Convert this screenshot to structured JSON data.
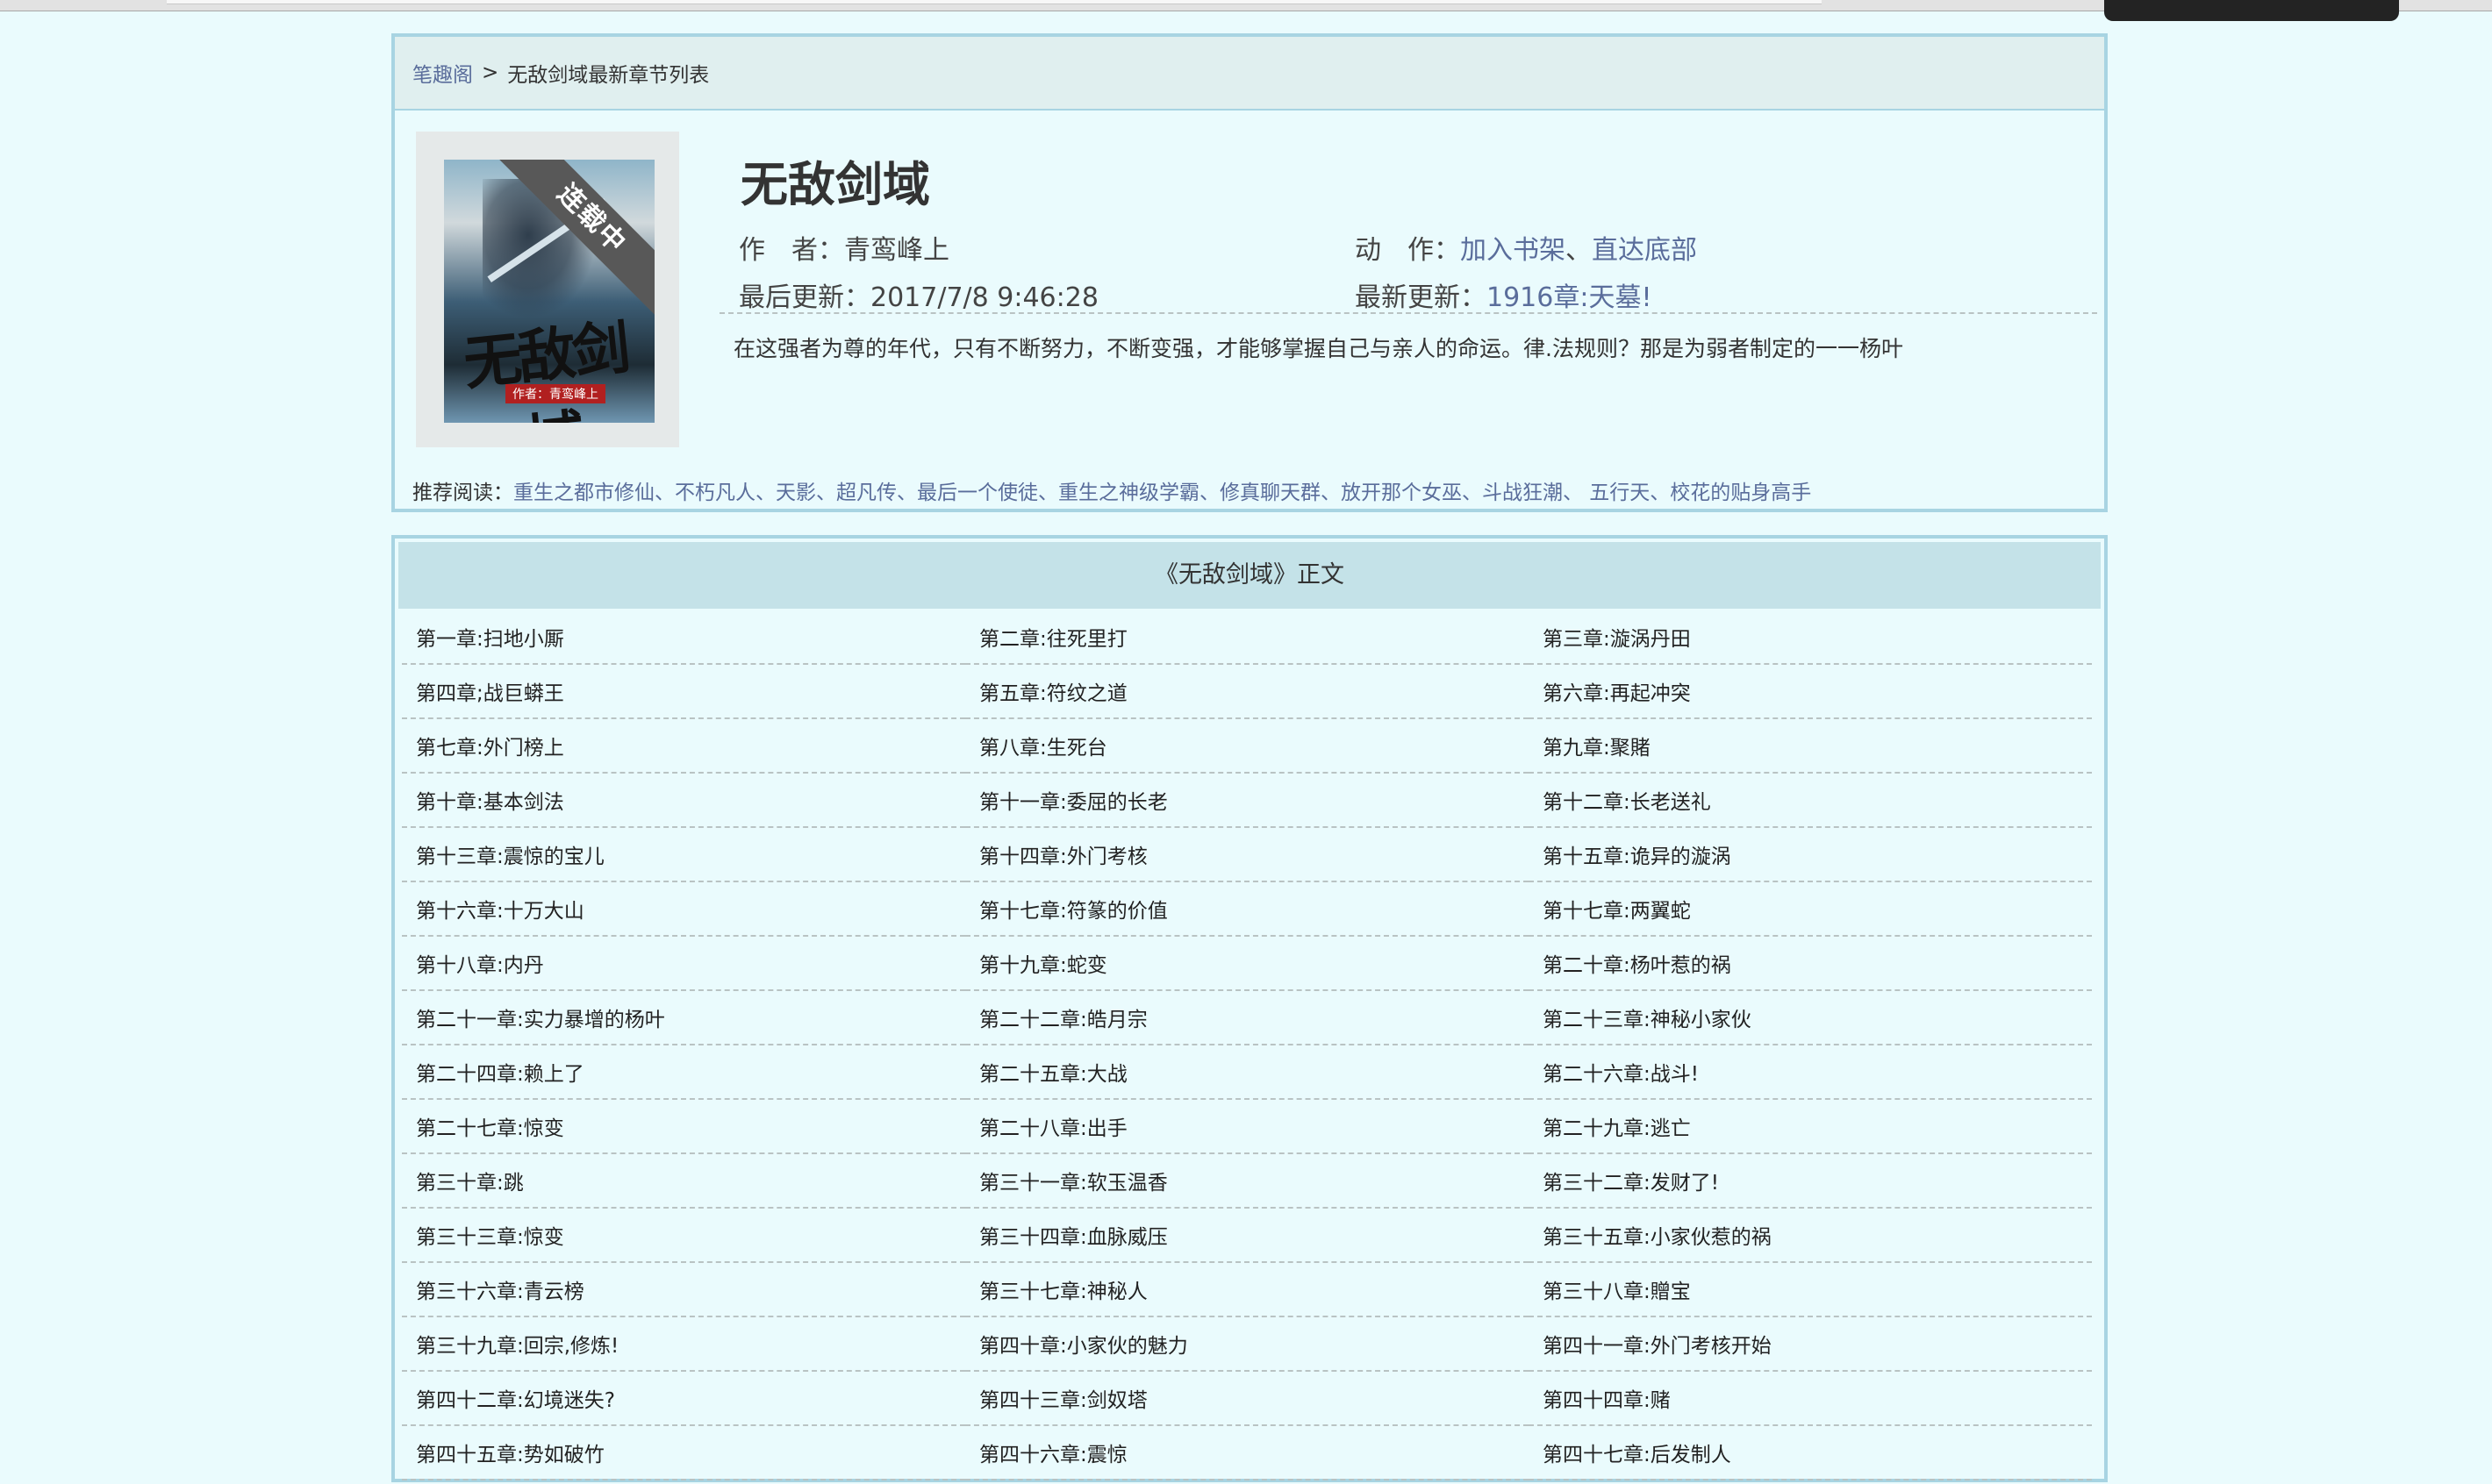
{
  "breadcrumb": {
    "home": "笔趣阁",
    "separator": ">",
    "current": "无敌剑域最新章节列表"
  },
  "book": {
    "cover_ribbon": "连载中",
    "cover_title": "无敌剑域",
    "cover_author": "作者：青鸾峰上",
    "title": "无敌剑域",
    "author_label": "作　者：",
    "author": "青鸾峰上",
    "action_label": "动　作：",
    "action_shelf": "加入书架",
    "action_sep": "、",
    "action_bottom": "直达底部",
    "updated_label": "最后更新：",
    "updated": "2017/7/8 9:46:28",
    "latest_label": "最新更新：",
    "latest": "1916章:天墓!",
    "intro": "在这强者为尊的年代，只有不断努力，不断变强，才能够掌握自己与亲人的命运。律.法规则？那是为弱者制定的一一杨叶"
  },
  "recommend": {
    "label": "推荐阅读：",
    "list": "重生之都市修仙、不朽凡人、天影、超凡传、最后一个使徒、重生之神级学霸、修真聊天群、放开那个女巫、斗战狂潮、 五行天、校花的贴身高手"
  },
  "chapters": {
    "header": "《无敌剑域》正文",
    "items": [
      "第一章:扫地小厮",
      "第二章:往死里打",
      "第三章:漩涡丹田",
      "第四章;战巨蟒王",
      "第五章:符纹之道",
      "第六章:再起冲突",
      "第七章:外门榜上",
      "第八章:生死台",
      "第九章:聚賭",
      "第十章:基本剑法",
      "第十一章:委屈的长老",
      "第十二章:长老送礼",
      "第十三章:震惊的宝儿",
      "第十四章:外门考核",
      "第十五章:诡异的漩涡",
      "第十六章:十万大山",
      "第十七章:符篆的价值",
      "第十七章:两翼蛇",
      "第十八章:内丹",
      "第十九章:蛇变",
      "第二十章:杨叶惹的祸",
      "第二十一章:实力暴增的杨叶",
      "第二十二章:皓月宗",
      "第二十三章:神秘小家伙",
      "第二十四章:赖上了",
      "第二十五章:大战",
      "第二十六章:战斗!",
      "第二十七章:惊变",
      "第二十八章:出手",
      "第二十九章:逃亡",
      "第三十章:跳",
      "第三十一章:软玉温香",
      "第三十二章:发财了!",
      "第三十三章:惊变",
      "第三十四章:血脉威压",
      "第三十五章:小家伙惹的祸",
      "第三十六章:青云榜",
      "第三十七章:神秘人",
      "第三十八章:贈宝",
      "第三十九章:回宗,修炼!",
      "第四十章:小家伙的魅力",
      "第四十一章:外门考核开始",
      "第四十二章:幻境迷失?",
      "第四十三章:剑奴塔",
      "第四十四章:赌",
      "第四十五章:势如破竹",
      "第四十六章:震惊",
      "第四十七章:后发制人"
    ]
  }
}
